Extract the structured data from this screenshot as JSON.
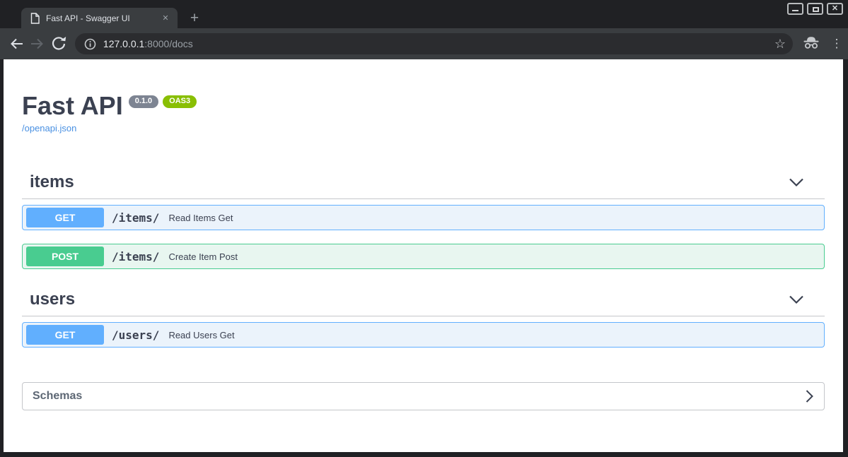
{
  "browser": {
    "tab": {
      "title": "Fast API - Swagger UI",
      "close_glyph": "✕"
    },
    "new_tab_glyph": "+",
    "window_controls": {
      "close_glyph": "✕"
    },
    "url": {
      "host": "127.0.0.1",
      "rest": ":8000/docs"
    },
    "icons": {
      "star": "☆",
      "menu": "⋮"
    }
  },
  "api": {
    "title": "Fast API",
    "version_badge": "0.1.0",
    "oas_badge": "OAS3",
    "spec_link": "/openapi.json",
    "sections": [
      {
        "name": "items",
        "rows": [
          {
            "method": "GET",
            "path": "/items/",
            "summary": "Read Items Get"
          },
          {
            "method": "POST",
            "path": "/items/",
            "summary": "Create Item Post"
          }
        ]
      },
      {
        "name": "users",
        "rows": [
          {
            "method": "GET",
            "path": "/users/",
            "summary": "Read Users Get"
          }
        ]
      }
    ],
    "schemas_label": "Schemas"
  },
  "colors": {
    "get_accent": "#61affe",
    "post_accent": "#49cc90",
    "version_badge_bg": "#7d8492",
    "oas3_badge_bg": "#89bf04",
    "link_blue": "#4990e2",
    "heading_text": "#3b4151",
    "toolbar_bg": "#3a3d40",
    "frame_bg": "#202124"
  }
}
